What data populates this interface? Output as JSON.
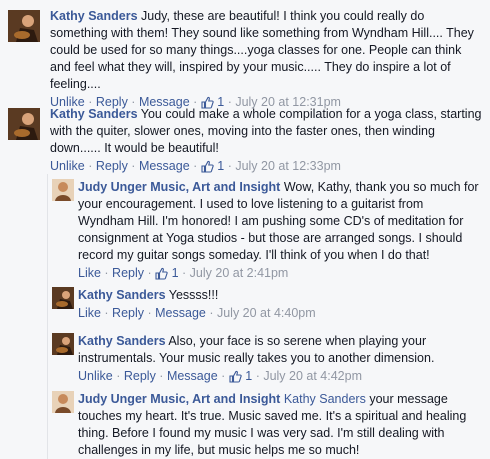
{
  "colors": {
    "link": "#3b5998",
    "meta": "#9197a3",
    "background": "#f6f7f9"
  },
  "icons": {
    "like": "thumbs-up-icon"
  },
  "comments": [
    {
      "author": "Kathy Sanders",
      "text": "Judy, these are beautiful! I think you could really do something with them! They sound like something from Wyndham Hill.... They could be used for so many things....yoga classes for one. People can think and feel what they will, inspired by your music..... They do inspire a lot of feeling....",
      "actions": [
        "Unlike",
        "Reply",
        "Message"
      ],
      "likes": "1",
      "time": "July 20 at 12:31pm"
    },
    {
      "author": "Kathy Sanders",
      "text": "You could make a whole compilation for a yoga class, starting with the quiter, slower ones, moving into the faster ones, then winding down...... It would be beautiful!",
      "actions": [
        "Unlike",
        "Reply",
        "Message"
      ],
      "likes": "1",
      "time": "July 20 at 12:33pm"
    },
    {
      "author": "Judy Unger Music, Art and Insight",
      "text": "Wow, Kathy, thank you so much for your encouragement. I used to love listening to a guitarist from Wyndham Hill. I'm honored! I am pushing some CD's of meditation for consignment at Yoga studios - but those are arranged songs. I should record my guitar songs someday. I'll think of you when I do that!",
      "actions": [
        "Like",
        "Reply"
      ],
      "likes": "1",
      "time": "July 20 at 2:41pm"
    },
    {
      "author": "Kathy Sanders",
      "text": "Yessss!!!",
      "actions": [
        "Like",
        "Reply",
        "Message"
      ],
      "likes": "",
      "time": "July 20 at 4:40pm"
    },
    {
      "author": "Kathy Sanders",
      "text": "Also, your face is so serene when playing your instrumentals. Your music really takes you to another dimension.",
      "actions": [
        "Unlike",
        "Reply",
        "Message"
      ],
      "likes": "1",
      "time": "July 20 at 4:42pm"
    },
    {
      "author": "Judy Unger Music, Art and Insight",
      "mention": "Kathy Sanders",
      "text": "your message touches my heart. It's true. Music saved me. It's a spiritual and healing thing. Before I found my music I was very sad. I'm still dealing with challenges in my life, but music helps me so much!",
      "actions": [],
      "likes": "",
      "time": ""
    }
  ]
}
